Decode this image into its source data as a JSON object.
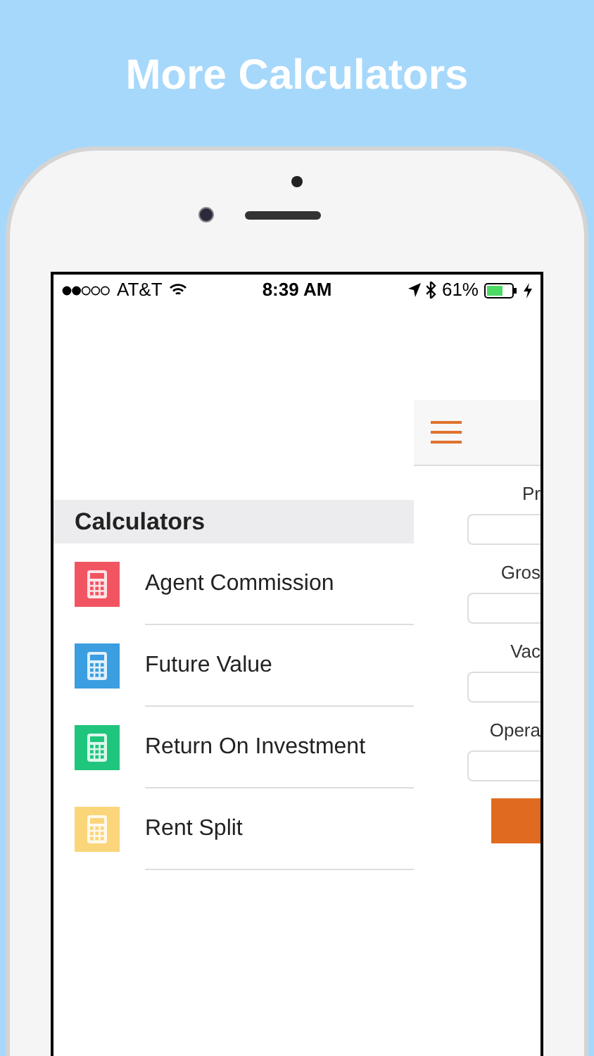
{
  "heading": "More Calculators",
  "status_bar": {
    "carrier": "AT&T",
    "time": "8:39 AM",
    "battery": "61%"
  },
  "menu": {
    "title": "Calculators",
    "items": [
      {
        "label": "Agent Commission",
        "color": "#f25562"
      },
      {
        "label": "Future Value",
        "color": "#3a9ee0"
      },
      {
        "label": "Return On Investment",
        "color": "#1fc57c"
      },
      {
        "label": "Rent Split",
        "color": "#fbd57a"
      }
    ]
  },
  "form": {
    "fields": [
      {
        "label": "Pr"
      },
      {
        "label": "Gros"
      },
      {
        "label": "Vac"
      },
      {
        "label": "Opera"
      }
    ]
  }
}
